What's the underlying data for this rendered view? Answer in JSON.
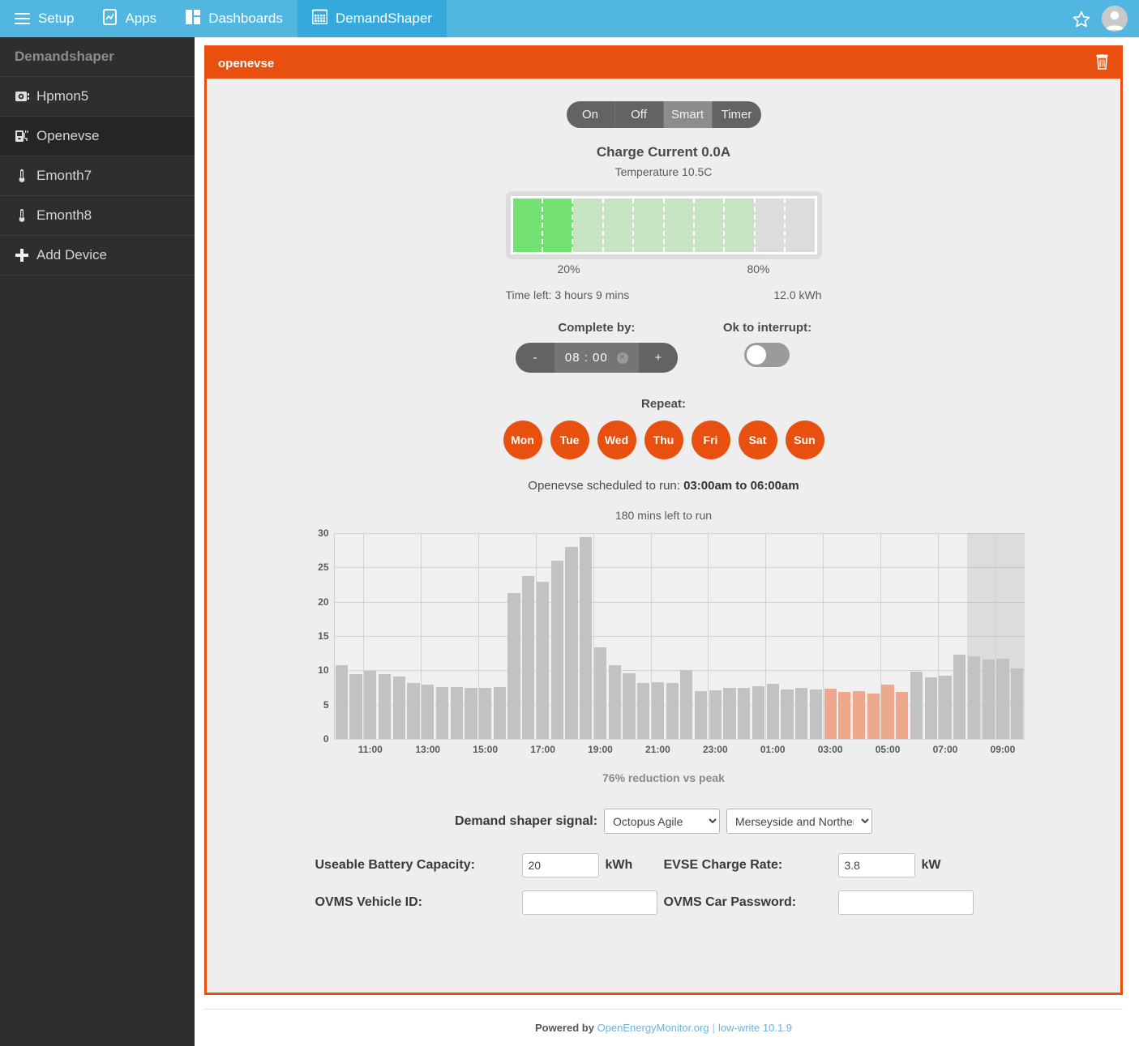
{
  "topnav": {
    "items": [
      {
        "label": "Setup",
        "icon": "hamburger-icon",
        "active": false
      },
      {
        "label": "Apps",
        "icon": "mobile-icon",
        "active": false
      },
      {
        "label": "Dashboards",
        "icon": "dashboard-icon",
        "active": false
      },
      {
        "label": "DemandShaper",
        "icon": "calendar-icon",
        "active": true
      }
    ],
    "star_icon": "star-icon",
    "avatar": "user-avatar-icon"
  },
  "sidebar": {
    "title": "Demandshaper",
    "items": [
      {
        "label": "Hpmon5",
        "icon": "heatpump-icon"
      },
      {
        "label": "Openevse",
        "icon": "evse-charger-icon"
      },
      {
        "label": "Emonth7",
        "icon": "thermometer-icon"
      },
      {
        "label": "Emonth8",
        "icon": "thermometer-icon"
      },
      {
        "label": "Add Device",
        "icon": "plus-icon"
      }
    ]
  },
  "panel": {
    "title": "openevse",
    "delete_icon": "trash-icon",
    "modes": [
      "On",
      "Off",
      "Smart",
      "Timer"
    ],
    "active_mode": "Smart",
    "charge_current": "Charge Current 0.0A",
    "temperature": "Temperature 10.5C",
    "battery": {
      "current_pct": 20,
      "target_pct": 80,
      "label_low": "20%",
      "label_high": "80%",
      "time_left": "Time left: 3 hours 9 mins",
      "energy": "12.0 kWh",
      "color_filled": "#73e072",
      "color_target": "#c6e3c2",
      "color_empty": "#dcdcdc"
    },
    "complete_by": {
      "label": "Complete by:",
      "minus": "-",
      "plus": "+",
      "value": "08 : 00",
      "clear_icon": "clear-x-icon"
    },
    "interrupt": {
      "label": "Ok to interrupt:",
      "state": "off"
    },
    "repeat": {
      "label": "Repeat:",
      "days": [
        "Mon",
        "Tue",
        "Wed",
        "Thu",
        "Fri",
        "Sat",
        "Sun"
      ],
      "active_color": "#e8500f"
    },
    "schedule_prefix": "Openevse scheduled to run: ",
    "schedule_time": "03:00am to 06:00am",
    "reduction": "76% reduction vs peak",
    "signal": {
      "label": "Demand shaper signal:",
      "tariff_value": "Octopus Agile",
      "tariff_options": [
        "Octopus Agile"
      ],
      "region_value": "Merseyside and Norther",
      "region_options": [
        "Merseyside and Norther"
      ]
    },
    "fields": {
      "battery_capacity_label": "Useable Battery Capacity:",
      "battery_capacity_value": "20",
      "battery_capacity_unit": "kWh",
      "charge_rate_label": "EVSE Charge Rate:",
      "charge_rate_value": "3.8",
      "charge_rate_unit": "kW",
      "ovms_id_label": "OVMS Vehicle ID:",
      "ovms_id_value": "",
      "ovms_pw_label": "OVMS Car Password:",
      "ovms_pw_value": ""
    }
  },
  "chart_data": {
    "type": "bar",
    "title": "180 mins left to run",
    "xlabel": "",
    "ylabel": "",
    "ylim": [
      0,
      30
    ],
    "yticks": [
      0,
      5,
      10,
      15,
      20,
      25,
      30
    ],
    "grid": true,
    "legend": null,
    "bar_colors": {
      "normal": "#c2c2c2",
      "scheduled": "#eda88d",
      "shaded_region": "rgba(150,150,150,0.22)"
    },
    "x_tick_labels": [
      "11:00",
      "13:00",
      "15:00",
      "17:00",
      "19:00",
      "21:00",
      "23:00",
      "01:00",
      "03:00",
      "05:00",
      "07:00",
      "09:00"
    ],
    "categories": [
      "10:00",
      "10:30",
      "11:00",
      "11:30",
      "12:00",
      "12:30",
      "13:00",
      "13:30",
      "14:00",
      "14:30",
      "15:00",
      "15:30",
      "16:00",
      "16:30",
      "17:00",
      "17:30",
      "18:00",
      "18:30",
      "19:00",
      "19:30",
      "20:00",
      "20:30",
      "21:00",
      "21:30",
      "22:00",
      "22:30",
      "23:00",
      "23:30",
      "00:00",
      "00:30",
      "01:00",
      "01:30",
      "02:00",
      "02:30",
      "03:00",
      "03:30",
      "04:00",
      "04:30",
      "05:00",
      "05:30",
      "06:00",
      "06:30",
      "07:00",
      "07:30",
      "08:00",
      "08:30",
      "09:00",
      "09:30"
    ],
    "values": [
      10.7,
      9.5,
      9.9,
      9.5,
      9.1,
      8.2,
      7.9,
      7.6,
      7.6,
      7.4,
      7.4,
      7.6,
      21.3,
      23.8,
      22.9,
      26.0,
      28.0,
      29.4,
      13.3,
      10.8,
      9.6,
      8.1,
      8.3,
      8.2,
      10.1,
      7.0,
      7.1,
      7.5,
      7.5,
      7.7,
      8.0,
      7.2,
      7.5,
      7.2,
      7.3,
      6.9,
      7.0,
      6.6,
      7.9,
      6.8,
      9.8,
      9.0,
      9.2,
      12.3,
      12.0,
      11.6,
      11.7,
      10.3
    ],
    "highlighted_indices": [
      34,
      35,
      36,
      37,
      38,
      39
    ],
    "shaded_from_index": 44,
    "annotation": "76% reduction vs peak"
  },
  "footer": {
    "powered_by": "Powered by",
    "link": "OpenEnergyMonitor.org",
    "separator": "|",
    "version": "low-write 10.1.9"
  }
}
